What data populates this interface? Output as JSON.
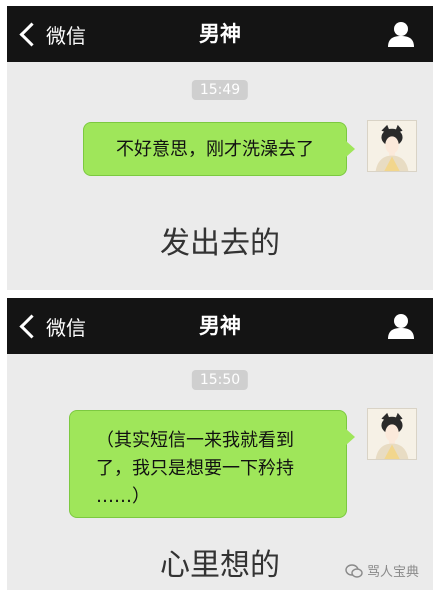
{
  "panels": [
    {
      "nav": {
        "back_label": "微信",
        "title": "男神"
      },
      "timestamp": "15:49",
      "message": "不好意思，刚才洗澡去了",
      "caption": "发出去的"
    },
    {
      "nav": {
        "back_label": "微信",
        "title": "男神"
      },
      "timestamp": "15:50",
      "message_lines": [
        "（其实短信一来我就看到",
        "了，我只是想要一下矜持",
        "……）"
      ],
      "caption": "心里想的"
    }
  ],
  "watermark": "骂人宝典",
  "colors": {
    "navbar": "#141414",
    "chat_bg": "#ebebeb",
    "bubble": "#9fe65a",
    "timestamp_bg": "#cfcfcf"
  },
  "icons": [
    "chevron-left-icon",
    "profile-icon",
    "avatar-image",
    "wechat-icon"
  ]
}
